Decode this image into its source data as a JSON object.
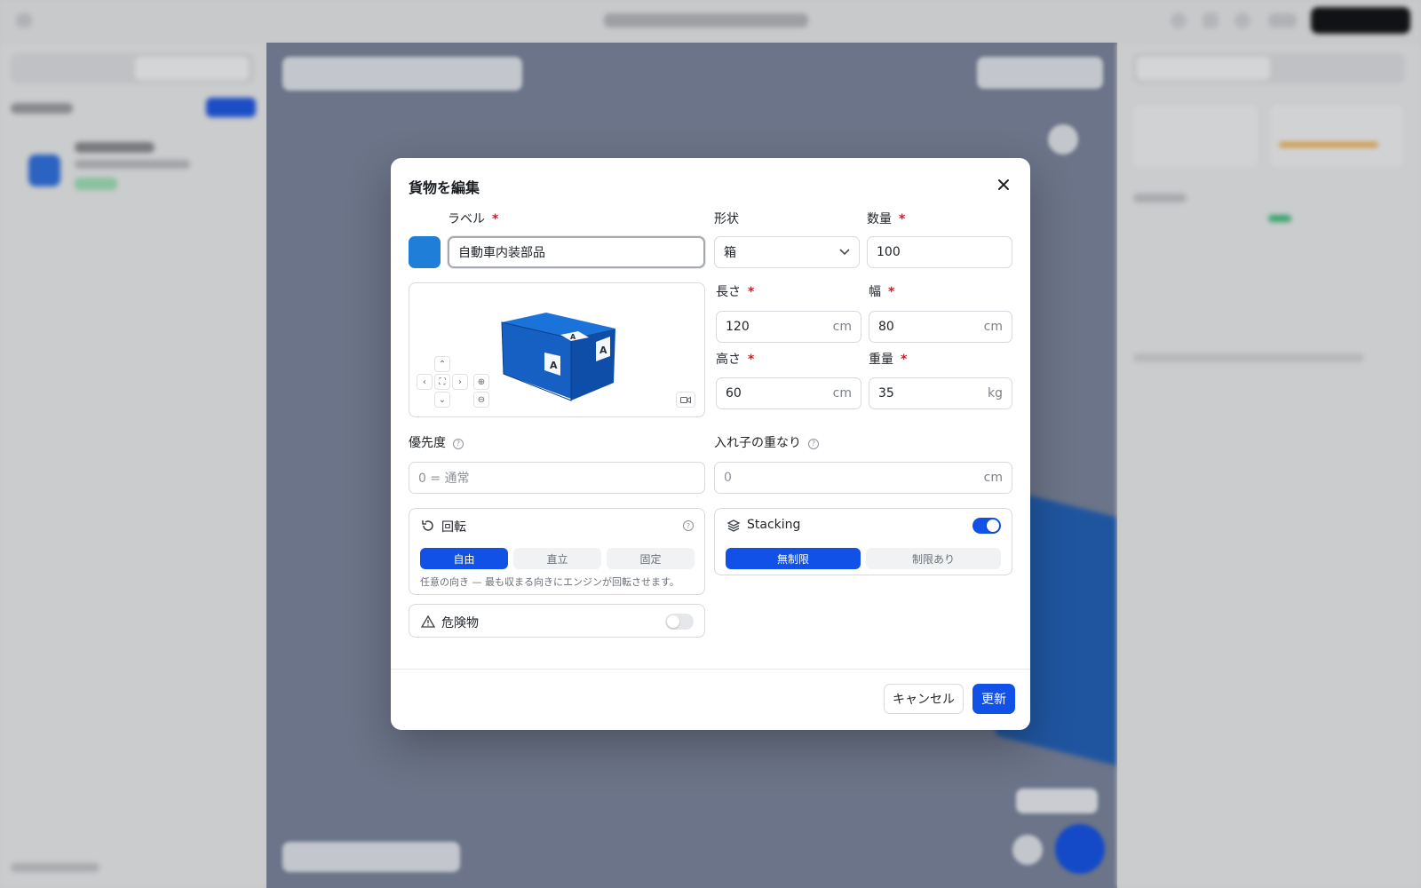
{
  "modal": {
    "title": "貨物を編集",
    "label_field": {
      "label": "ラベル",
      "required_mark": "*",
      "value": "自動車内装部品"
    },
    "color": "#1f7ed8",
    "shape_field": {
      "label": "形状",
      "selected": "箱"
    },
    "quantity_field": {
      "label": "数量",
      "required_mark": "*",
      "value": "100"
    },
    "length_field": {
      "label": "長さ",
      "required_mark": "*",
      "value": "120",
      "unit": "cm"
    },
    "width_field": {
      "label": "幅",
      "required_mark": "*",
      "value": "80",
      "unit": "cm"
    },
    "height_field": {
      "label": "高さ",
      "required_mark": "*",
      "value": "60",
      "unit": "cm"
    },
    "weight_field": {
      "label": "重量",
      "required_mark": "*",
      "value": "35",
      "unit": "kg"
    },
    "priority_field": {
      "label": "優先度",
      "placeholder": "0 = 通常"
    },
    "nesting_field": {
      "label": "入れ子の重なり",
      "placeholder": "0",
      "unit": "cm"
    },
    "preview": {
      "box_letter": "A"
    },
    "rotation": {
      "title": "回転",
      "options": [
        "自由",
        "直立",
        "固定"
      ],
      "selected": "自由",
      "hint": "任意の向き — 最も収まる向きにエンジンが回転させます。"
    },
    "stacking": {
      "title": "Stacking",
      "enabled": true,
      "options": [
        "無制限",
        "制限あり"
      ],
      "selected": "無制限"
    },
    "hazardous": {
      "title": "危険物",
      "enabled": false
    },
    "cancel_label": "キャンセル",
    "submit_label": "更新"
  },
  "colors": {
    "accent": "#1151e8",
    "required": "#d11a2a",
    "box_blue": "#1f7ed8"
  }
}
